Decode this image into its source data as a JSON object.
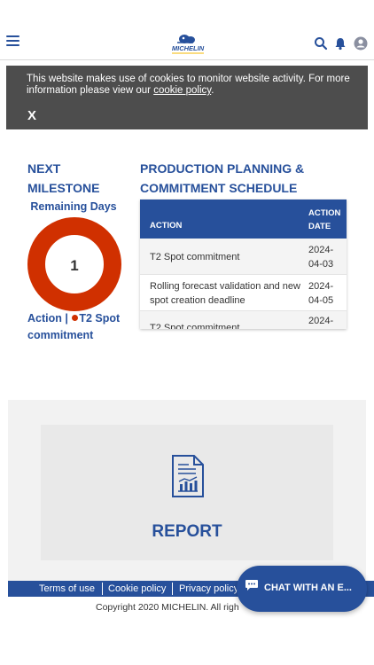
{
  "header": {
    "logo_text": "MICHELIN"
  },
  "cookie_banner": {
    "text_before": "This website makes use of cookies to monitor website activity. For more information please view our",
    "link_label": "cookie policy",
    "text_after": ".",
    "close_label": "X"
  },
  "milestone": {
    "title": "NEXT MILESTONE",
    "remaining_label": "Remaining Days",
    "days_value": "1",
    "action_label": "Action |",
    "action_name": "T2 Spot commitment",
    "ring_color": "#d03000"
  },
  "schedule": {
    "title": "PRODUCTION PLANNING & COMMITMENT SCHEDULE",
    "col_action": "ACTION",
    "col_date": "ACTION DATE",
    "rows": [
      {
        "action": "T2 Spot commitment",
        "date": "2024-04-03"
      },
      {
        "action": "Rolling forecast validation and new spot creation deadline",
        "date": "2024-04-05"
      },
      {
        "action": "T2 Spot commitment",
        "date": "2024-"
      }
    ]
  },
  "report": {
    "label": "REPORT"
  },
  "footer": {
    "links": [
      "Terms of use",
      "Cookie policy",
      "Privacy policy"
    ],
    "copyright": "Copyright 2020 MICHELIN. All righ"
  },
  "chat": {
    "label": "CHAT WITH AN E..."
  },
  "colors": {
    "brand_blue": "#27509b",
    "banner_gray": "#4d4d4d",
    "accent_red": "#d03000"
  }
}
